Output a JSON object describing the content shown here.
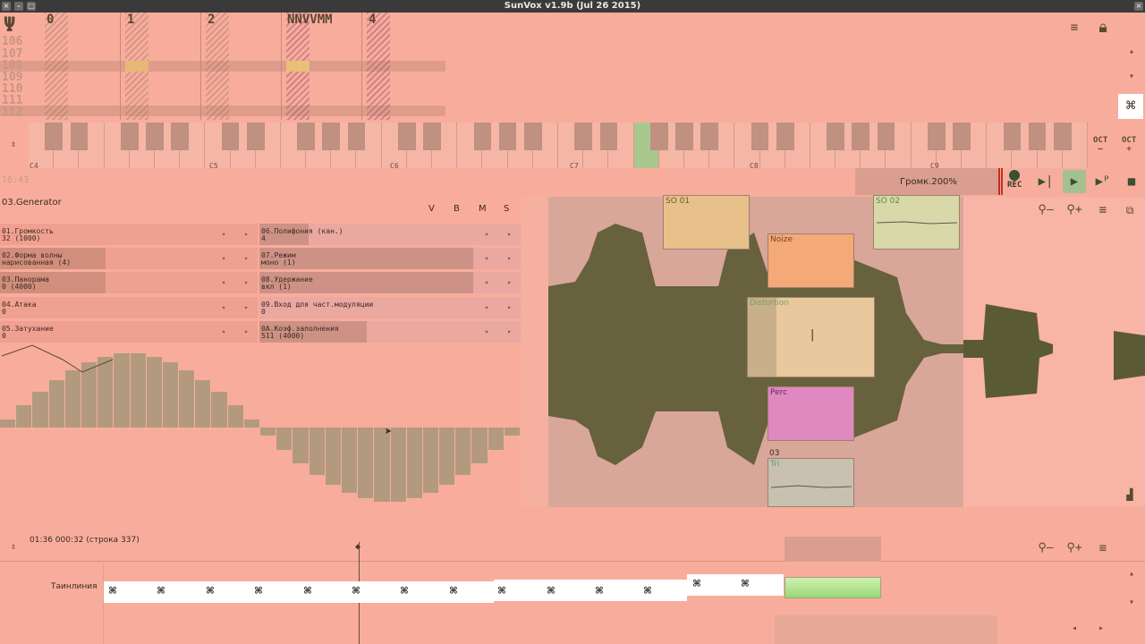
{
  "window": {
    "title": "SunVox v1.9b (Jul 26 2015)"
  },
  "pattern_editor": {
    "track_headers": [
      "0",
      "1",
      "2",
      "NNVVMM",
      "4"
    ],
    "row_numbers": [
      "106",
      "107",
      "108",
      "109",
      "110",
      "111",
      "112"
    ]
  },
  "piano": {
    "octave_labels": [
      "C4",
      "C5",
      "C6",
      "C7",
      "C8",
      "C9"
    ],
    "oct_down_label": "OCT",
    "oct_up_label": "OCT"
  },
  "status": {
    "timecode": "16:43",
    "volume_label": "Громк.200%",
    "rec_label": "REC"
  },
  "generator": {
    "title": "03.Generator",
    "header_buttons": [
      "V",
      "B",
      "M",
      "S"
    ],
    "params": [
      {
        "label": "01.Громкость",
        "value": "32 (1000)",
        "fill": 0.0
      },
      {
        "label": "06.Полифония (кан.)",
        "value": "4",
        "fill": 0.19
      },
      {
        "label": "02.Форма волны",
        "value": "нарисованная (4)",
        "fill": 0.41
      },
      {
        "label": "07.Режим",
        "value": "моно (1)",
        "fill": 0.82
      },
      {
        "label": "03.Панорама",
        "value": "0 (4000)",
        "fill": 0.41
      },
      {
        "label": "08.Удержание",
        "value": "вкл (1)",
        "fill": 0.82
      },
      {
        "label": "04.Атака",
        "value": "0",
        "fill": 0.0
      },
      {
        "label": "09.Вход для част.модуляции",
        "value": "0",
        "fill": 0.0
      },
      {
        "label": "05.Затухание",
        "value": "0",
        "fill": 0.0
      },
      {
        "label": "0A.Коэф.заполнения",
        "value": "511 (4000)",
        "fill": 0.41
      }
    ]
  },
  "modules": {
    "items": [
      {
        "name": "SO 01",
        "color": "#e8c08a"
      },
      {
        "name": "SO 02",
        "color": "#d8d8a8"
      },
      {
        "name": "Noize",
        "color": "#f5a878"
      },
      {
        "name": "Distortion",
        "color": "#e8c89c"
      },
      {
        "name": "Perc",
        "color": "#e088c0"
      },
      {
        "name": "03",
        "color": "#d8a898"
      },
      {
        "name": "Tri",
        "color": "#c8c0b0"
      }
    ]
  },
  "timeline": {
    "time_info": "01:36 000:32 (строка 337)",
    "track_label": "Таинлиния"
  }
}
